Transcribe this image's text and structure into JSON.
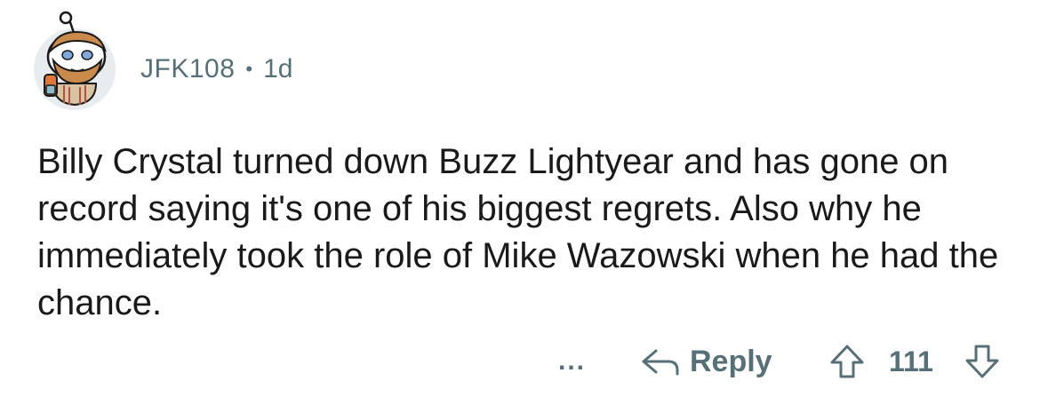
{
  "comment": {
    "username": "JFK108",
    "separator": "•",
    "age": "1d",
    "text": "Billy Crystal turned down Buzz Lightyear and has gone on record saying it's one of his biggest regrets. Also why he immediately took the role of Mike Wazowski when he had the chance.",
    "avatar_icon": "snoo-avatar-icon"
  },
  "actions": {
    "more_label": "...",
    "reply_label": "Reply",
    "score": "111",
    "reply_icon": "reply-arrow-icon",
    "upvote_icon": "upvote-arrow-icon",
    "downvote_icon": "downvote-arrow-icon"
  },
  "colors": {
    "text": "#1a1a1b",
    "meta": "#576f76",
    "avatar_bg": "#e9ecef",
    "beard": "#c98a4b"
  }
}
